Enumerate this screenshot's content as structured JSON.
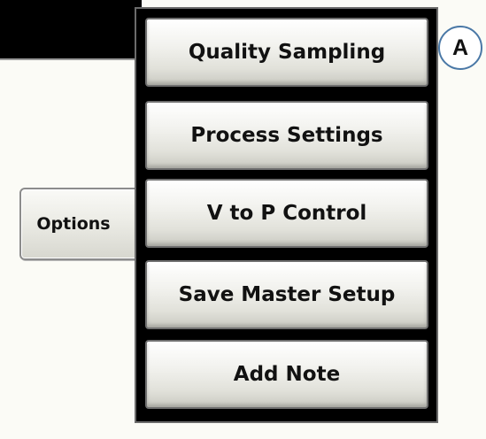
{
  "options_button": {
    "label": "Options"
  },
  "menu": {
    "items": [
      {
        "label": "Quality Sampling"
      },
      {
        "label": "Process Settings"
      },
      {
        "label": "V to P Control"
      },
      {
        "label": "Save Master Setup"
      },
      {
        "label": "Add Note"
      }
    ]
  },
  "callout": {
    "label": "A"
  },
  "colors": {
    "background": "#fbfbf6",
    "panel": "#000000",
    "callout_border": "#4a78a6"
  }
}
